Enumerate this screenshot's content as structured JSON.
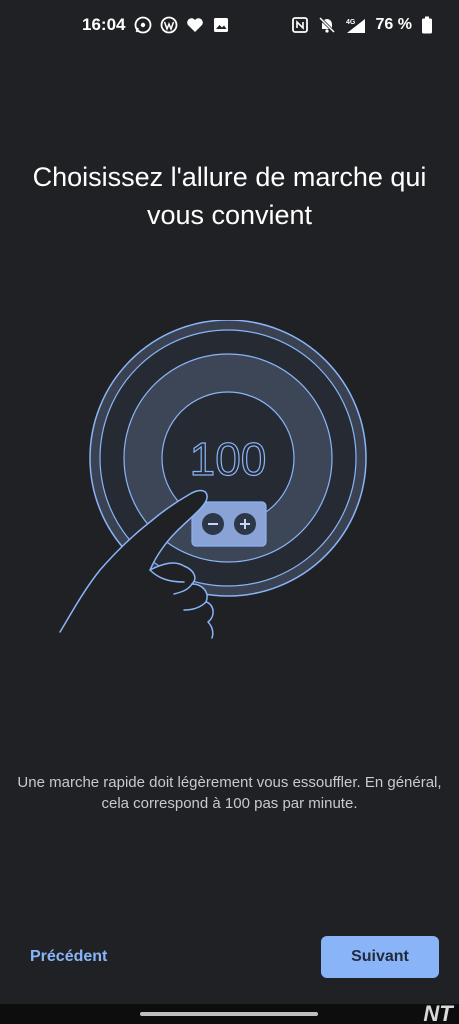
{
  "status_bar": {
    "time": "16:04",
    "left_icons": [
      "whatsapp-icon",
      "wordpress-icon",
      "heart-icon",
      "image-icon"
    ],
    "right_icons": [
      "nfc-icon",
      "bell-off-icon",
      "signal-4g-icon",
      "battery-icon"
    ],
    "network": "4G",
    "battery": "76 %"
  },
  "page": {
    "title": "Choisissez l'allure de marche qui vous convient",
    "dial_value": "100",
    "description": "Une marche rapide doit légèrement vous essouffler. En général, cela correspond à 100 pas par minute."
  },
  "navigation": {
    "previous_label": "Précédent",
    "next_label": "Suivant"
  },
  "watermark": "NT",
  "colors": {
    "background": "#202124",
    "accent": "#8ab4f8",
    "text": "#ffffff",
    "muted_text": "#c8cacd"
  }
}
